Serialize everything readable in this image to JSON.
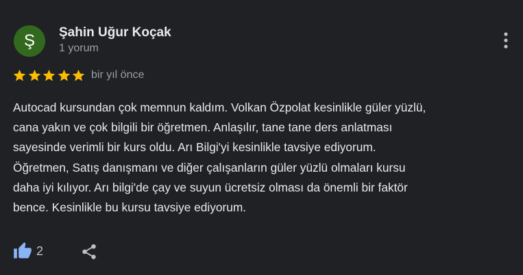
{
  "reviewer": {
    "initial": "Ş",
    "name": "Şahin Uğur Koçak",
    "review_count": "1 yorum",
    "avatar_color": "#33691e"
  },
  "rating": {
    "stars": 5,
    "max_stars": 5,
    "star_color": "#fbbc04",
    "date": "bir yıl önce"
  },
  "review_text": [
    "Autocad kursundan çok memnun kaldım. Volkan Özpolat kesinlikle güler yüzlü,",
    "cana yakın ve çok bilgili bir öğretmen. Anlaşılır, tane tane ders anlatması",
    "sayesinde verimli bir kurs oldu. Arı Bilgi'yi kesinlikle tavsiye ediyorum.",
    "Öğretmen, Satış danışmanı ve diğer çalışanların güler yüzlü olmaları kursu",
    "daha iyi kılıyor. Arı bilgi'de çay ve suyun ücretsiz olması da önemli bir faktör",
    "bence. Kesinlikle bu kursu tavsiye ediyorum."
  ],
  "actions": {
    "like_count": "2",
    "like_icon": "thumbs-up-icon",
    "share_icon": "share-icon",
    "more_icon": "more-vert-icon",
    "like_color": "#8ab4f8",
    "icon_color": "#bdc1c6"
  }
}
